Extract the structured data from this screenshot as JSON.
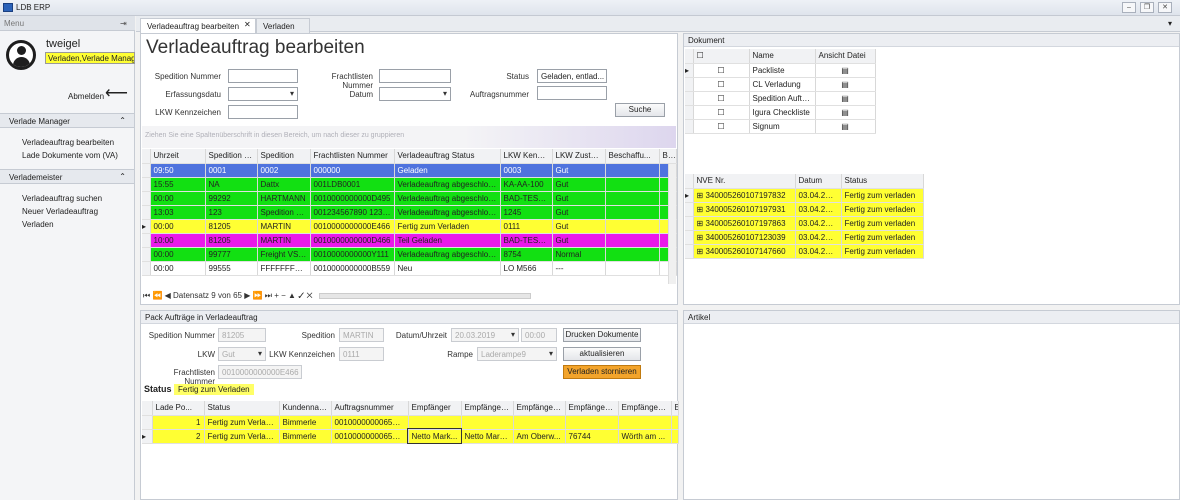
{
  "app": {
    "title": "LDB ERP"
  },
  "colors": {
    "blue": "#4f73de",
    "green": "#12e012",
    "yellow": "#ffff33",
    "magenta": "#ea19ea",
    "orange": "#f3a42b"
  },
  "sidebar": {
    "header": "Menu",
    "user": {
      "name": "tweigel",
      "roles": "Verladen,Verlade Manage"
    },
    "logout": "Abmelden",
    "groups": [
      {
        "title": "Verlade Manager",
        "items": [
          "Verladeauftrag bearbeiten",
          "Lade Dokumente vom (VA)"
        ]
      },
      {
        "title": "Verlademeister",
        "items": [
          "Verladeauftrag suchen",
          "Neuer Verladeauftrag",
          "Verladen"
        ]
      }
    ]
  },
  "tabs": [
    {
      "label": "Verladeauftrag bearbeiten",
      "active": true
    },
    {
      "label": "Verladen",
      "active": false
    }
  ],
  "form": {
    "title": "Verladeauftrag bearbeiten",
    "spedition_nr_label": "Spedition Nummer",
    "frachtlisten_nr_label": "Frachtlisten Nummer",
    "status_label": "Status",
    "status_value": "Geladen, entlad...",
    "erfassungsdatum_label": "Erfassungsdatu",
    "datum_label": "Datum",
    "auftragsnummer_label": "Auftragsnummer",
    "lkw_label": "LKW Kennzeichen",
    "search_button": "Suche"
  },
  "grid": {
    "group_hint": "Ziehen Sie eine Spaltenüberschrift in diesen Bereich, um nach dieser zu gruppieren",
    "columns": [
      "Uhrzeit",
      "Spedition N...",
      "Spedition",
      "Frachtlisten Nummer",
      "Verladeauftrag Status",
      "LKW Kennz...",
      "LKW Zustand",
      "Beschaffu...",
      "Bes"
    ],
    "rows": [
      {
        "color": "blue",
        "cells": [
          "09:50",
          "0001",
          "0002",
          "000000",
          "Geladen",
          "0003",
          "Gut",
          "",
          ""
        ]
      },
      {
        "color": "green",
        "cells": [
          "15:55",
          "NA",
          "Dattx",
          "001LDB0001",
          "Verladeauftrag abgeschlossen",
          "KA-AA-100",
          "Gut",
          "",
          ""
        ]
      },
      {
        "color": "green",
        "cells": [
          "00:00",
          "99292",
          "HARTMANN",
          "0010000000000D495",
          "Verladeauftrag abgeschlossen",
          "BAD-TEST ...",
          "Gut",
          "",
          ""
        ]
      },
      {
        "color": "green",
        "cells": [
          "13:03",
          "123",
          "Spedition XYZ",
          "001234567890 12345",
          "Verladeauftrag abgeschlossen",
          "1245",
          "Gut",
          "",
          ""
        ]
      },
      {
        "color": "yellow",
        "current": true,
        "cells": [
          "00:00",
          "81205",
          "MARTIN",
          "0010000000000E466",
          "Fertig zum Verladen",
          "0111",
          "Gut",
          "",
          ""
        ]
      },
      {
        "color": "magenta",
        "cells": [
          "10:00",
          "81205",
          "MARTIN",
          "0010000000000D466",
          "Teil Geladen",
          "BAD-TEST ...",
          "Gut",
          "",
          ""
        ]
      },
      {
        "color": "green",
        "cells": [
          "00:00",
          "99777",
          "Freight VSS...",
          "0010000000000Y111",
          "Verladeauftrag abgeschlossen",
          "8754",
          "Normal",
          "",
          ""
        ]
      },
      {
        "color": "white",
        "cells": [
          "00:00",
          "99555",
          "FFFFFFFF ...",
          "0010000000000B559",
          "Neu",
          "LO M566",
          "---",
          "",
          ""
        ]
      }
    ],
    "navigator": "Datensatz 9 von 65"
  },
  "pack": {
    "title": "Pack Aufträge in Verladeauftrag",
    "spedition_nr_label": "Spedition Nummer",
    "spedition_nr": "81205",
    "spedition_label": "Spedition",
    "spedition": "MARTIN",
    "datum_label": "Datum/Uhrzeit",
    "datum": "20.03.2019",
    "uhrzeit": "00:00",
    "drucken": "Drucken Dokumente",
    "lkw_label": "LKW",
    "lkw": "Gut",
    "lkw_kz_label": "LKW Kennzeichen",
    "lkw_kz": "0111",
    "rampe_label": "Rampe",
    "rampe": "Laderampe9",
    "aktualisieren": "aktualisieren",
    "frachtlisten_label": "Frachtlisten Nummer",
    "frachtlisten": "0010000000000E466",
    "stornieren": "Verladen stornieren",
    "status_label": "Status :",
    "status": "Fertig zum Verladen",
    "columns": [
      "Lade Po...",
      "Status",
      "Kundenname",
      "Auftragsnummer",
      "Empfänger",
      "Empfänger ...",
      "Empfänger ...",
      "Empfänger ...",
      "Empfänger ...",
      "E"
    ],
    "rows": [
      {
        "cells": [
          "1",
          "Fertig zum Verladen",
          "Bimmerle",
          "00100000000657161",
          "",
          "",
          "",
          "",
          "",
          ""
        ]
      },
      {
        "current": true,
        "cells": [
          "2",
          "Fertig zum Verladen",
          "Bimmerle",
          "00100000000657143",
          "Netto Mark...",
          "Netto Mark...",
          "Am Oberw...",
          "76744",
          "Wörth am ...",
          ""
        ]
      }
    ]
  },
  "dokument": {
    "title": "Dokument",
    "columns": [
      "Name",
      "Ansicht Datei"
    ],
    "rows": [
      "Packliste",
      "CL Verladung",
      "Spedition Auftrag",
      "Igura Checkliste",
      "Signum"
    ]
  },
  "nve": {
    "columns": [
      "NVE Nr.",
      "Datum",
      "Status"
    ],
    "rows": [
      [
        "340005260107197832",
        "03.04.2019",
        "Fertig zum verladen"
      ],
      [
        "340005260107197931",
        "03.04.2019",
        "Fertig zum verladen"
      ],
      [
        "340005260107197863",
        "03.04.2019",
        "Fertig zum verladen"
      ],
      [
        "340005260107123039",
        "03.04.2019",
        "Fertig zum verladen"
      ],
      [
        "340005260107147660",
        "03.04.2019",
        "Fertig zum verladen"
      ]
    ]
  },
  "artikel": {
    "title": "Artikel"
  }
}
